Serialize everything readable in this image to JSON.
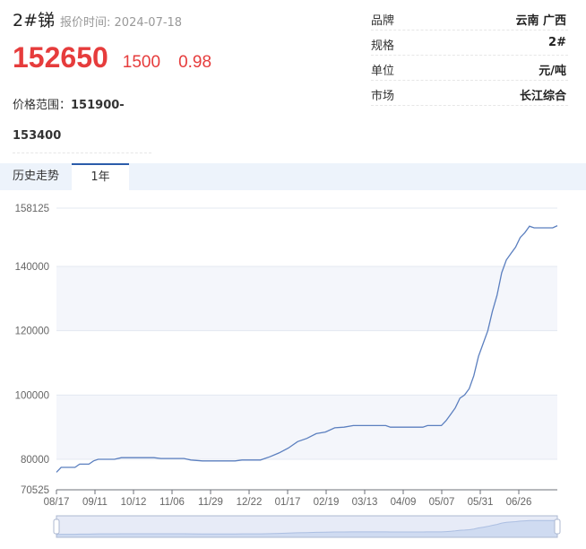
{
  "header": {
    "title": "2#锑",
    "date_label": "报价时间: 2024-07-18",
    "price": "152650",
    "change": "1500",
    "change_pct": "0.98",
    "range_label": "价格范围：",
    "range_low": "151900-",
    "range_high": "153400"
  },
  "specs": [
    {
      "key": "品牌",
      "value": "云南 广西"
    },
    {
      "key": "规格",
      "value": "2#"
    },
    {
      "key": "单位",
      "value": "元/吨"
    },
    {
      "key": "市场",
      "value": "长江综合"
    }
  ],
  "tabs": [
    {
      "label": "历史走势",
      "active": false
    },
    {
      "label": "1年",
      "active": true
    }
  ],
  "colors": {
    "up": "#e63c3c",
    "line": "#5b7fbf",
    "tab_active": "#2b5caa"
  },
  "chart_data": {
    "type": "line",
    "y_ticks": [
      "70525",
      "80000",
      "100000",
      "120000",
      "140000",
      "158125"
    ],
    "x_ticks": [
      "08/17",
      "09/11",
      "10/12",
      "11/06",
      "11/29",
      "12/22",
      "01/17",
      "02/19",
      "03/13",
      "04/09",
      "05/07",
      "05/31",
      "06/26"
    ],
    "ylim": [
      70525,
      158125
    ],
    "grid": true,
    "series": [
      {
        "values": [
          [
            0,
            76000
          ],
          [
            2,
            77500
          ],
          [
            8,
            77500
          ],
          [
            10,
            78500
          ],
          [
            14,
            78500
          ],
          [
            16,
            79500
          ],
          [
            18,
            80000
          ],
          [
            25,
            80000
          ],
          [
            28,
            80500
          ],
          [
            42,
            80500
          ],
          [
            45,
            80250
          ],
          [
            55,
            80250
          ],
          [
            58,
            79800
          ],
          [
            63,
            79500
          ],
          [
            77,
            79500
          ],
          [
            80,
            79800
          ],
          [
            88,
            79800
          ],
          [
            92,
            80800
          ],
          [
            96,
            82000
          ],
          [
            100,
            83500
          ],
          [
            104,
            85500
          ],
          [
            108,
            86500
          ],
          [
            112,
            88000
          ],
          [
            116,
            88500
          ],
          [
            120,
            89800
          ],
          [
            124,
            90000
          ],
          [
            128,
            90500
          ],
          [
            142,
            90500
          ],
          [
            144,
            90000
          ],
          [
            158,
            90000
          ],
          [
            160,
            90500
          ],
          [
            166,
            90500
          ],
          [
            168,
            92000
          ],
          [
            170,
            94000
          ],
          [
            172,
            96000
          ],
          [
            174,
            99000
          ],
          [
            176,
            100000
          ],
          [
            178,
            102000
          ],
          [
            180,
            106000
          ],
          [
            182,
            112000
          ],
          [
            184,
            116000
          ],
          [
            186,
            120000
          ],
          [
            188,
            126000
          ],
          [
            190,
            131000
          ],
          [
            192,
            138000
          ],
          [
            194,
            142000
          ],
          [
            196,
            144000
          ],
          [
            198,
            146000
          ],
          [
            200,
            149000
          ],
          [
            202,
            150500
          ],
          [
            204,
            152500
          ],
          [
            206,
            152000
          ],
          [
            210,
            152000
          ],
          [
            214,
            152000
          ],
          [
            216,
            152650
          ]
        ]
      }
    ]
  }
}
